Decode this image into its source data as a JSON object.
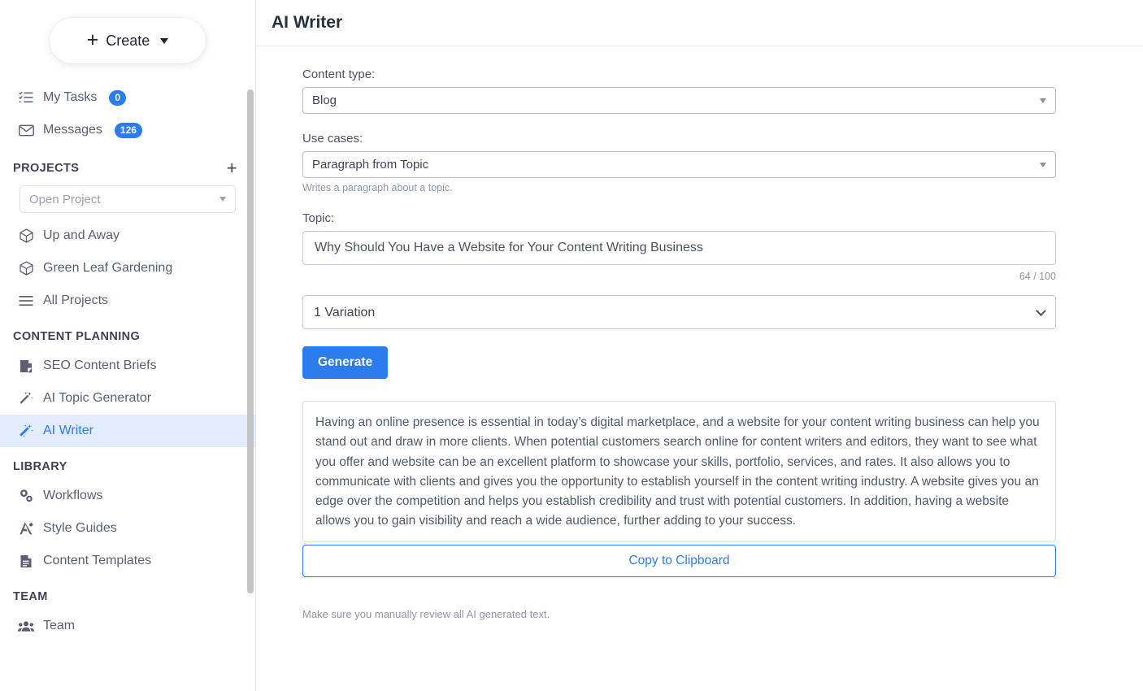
{
  "sidebar": {
    "create_button": {
      "label": "Create",
      "icon": "plus-icon",
      "caret": "chevron-down-icon"
    },
    "nav": [
      {
        "label": "My Tasks",
        "icon": "task-list-icon",
        "badge": "0"
      },
      {
        "label": "Messages",
        "icon": "envelope-icon",
        "badge": "126"
      }
    ],
    "projects_section": {
      "title": "PROJECTS",
      "add_icon": "plus-icon",
      "open_project_placeholder": "Open Project",
      "items": [
        {
          "label": "Up and Away",
          "icon": "cube-icon"
        },
        {
          "label": "Green Leaf Gardening",
          "icon": "cube-icon"
        },
        {
          "label": "All Projects",
          "icon": "list-icon"
        }
      ]
    },
    "content_planning_section": {
      "title": "CONTENT PLANNING",
      "items": [
        {
          "label": "SEO Content Briefs",
          "icon": "document-icon",
          "active": false
        },
        {
          "label": "AI Topic Generator",
          "icon": "magic-wand-icon",
          "active": false
        },
        {
          "label": "AI Writer",
          "icon": "magic-wand-sparkle-icon",
          "active": true
        }
      ]
    },
    "library_section": {
      "title": "LIBRARY",
      "items": [
        {
          "label": "Workflows",
          "icon": "gears-icon"
        },
        {
          "label": "Style Guides",
          "icon": "pen-compass-icon"
        },
        {
          "label": "Content Templates",
          "icon": "file-lines-icon"
        }
      ]
    },
    "team_section": {
      "title": "TEAM",
      "items": [
        {
          "label": "Team",
          "icon": "people-icon"
        }
      ]
    }
  },
  "header": {
    "title": "AI Writer"
  },
  "form": {
    "content_type_label": "Content type:",
    "content_type_value": "Blog",
    "use_cases_label": "Use cases:",
    "use_cases_value": "Paragraph from Topic",
    "use_cases_hint": "Writes a paragraph about a topic.",
    "topic_label": "Topic:",
    "topic_value": "Why Should You Have a Website for Your Content Writing Business",
    "topic_counter": "64 / 100",
    "variation_value": "1 Variation",
    "generate_label": "Generate"
  },
  "result": {
    "text": "Having an online presence is essential in today’s digital marketplace, and a website for your content writing business can help you stand out and draw in more clients. When potential customers search online for content writers and editors, they want to see what you offer and website can be an excellent platform to showcase your skills, portfolio, services, and rates. It also allows you to communicate with clients and gives you the opportunity to establish yourself in the content writing industry. A website gives you an edge over the competition and helps you establish credibility and trust with potential customers. In addition, having a website allows you to gain visibility and reach a wide audience, further adding to your success.",
    "copy_label": "Copy to Clipboard",
    "footnote": "Make sure you manually review all AI generated text."
  },
  "colors": {
    "accent": "#2b7ded",
    "active_bg": "#e3ecfd",
    "muted": "#8f95a3"
  }
}
